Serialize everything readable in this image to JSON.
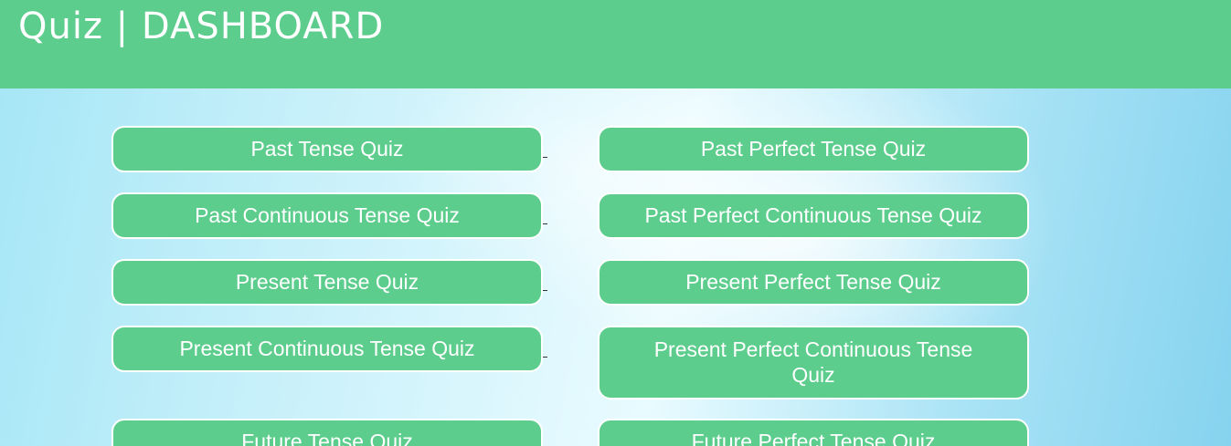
{
  "header": {
    "title": "Quiz | DASHBOARD"
  },
  "quizzes": {
    "left": [
      {
        "label": "Past Tense Quiz"
      },
      {
        "label": "Past Continuous Tense Quiz"
      },
      {
        "label": "Present Tense Quiz"
      },
      {
        "label": "Present Continuous Tense Quiz"
      },
      {
        "label": "Future Tense Quiz"
      }
    ],
    "right": [
      {
        "label": "Past Perfect Tense Quiz"
      },
      {
        "label": "Past Perfect Continuous Tense Quiz"
      },
      {
        "label": "Present Perfect Tense Quiz"
      },
      {
        "label": "Present Perfect Continuous Tense Quiz"
      },
      {
        "label": "Future Perfect Tense Quiz"
      }
    ]
  },
  "colors": {
    "header_bg": "#5ccd8c",
    "button_bg": "#5ccd8c",
    "button_text": "#ffffff"
  }
}
